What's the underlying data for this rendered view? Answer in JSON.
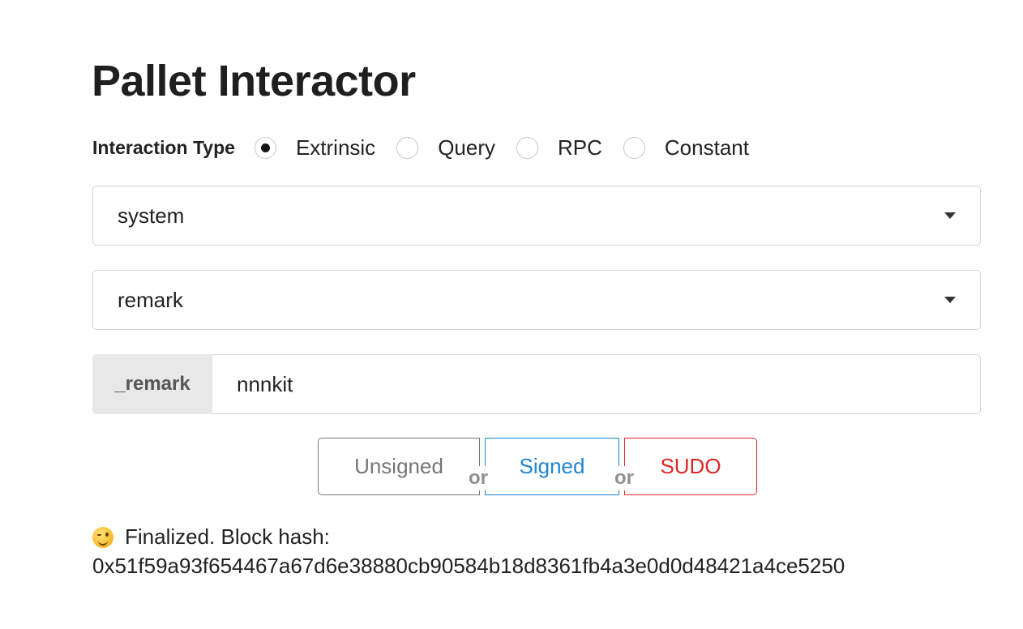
{
  "page": {
    "title": "Pallet Interactor"
  },
  "interaction_type": {
    "label": "Interaction Type",
    "options": [
      {
        "label": "Extrinsic",
        "checked": true
      },
      {
        "label": "Query",
        "checked": false
      },
      {
        "label": "RPC",
        "checked": false
      },
      {
        "label": "Constant",
        "checked": false
      }
    ]
  },
  "pallet_select": {
    "value": "system"
  },
  "callable_select": {
    "value": "remark"
  },
  "param_input": {
    "label": "_remark",
    "value": "nnnkit"
  },
  "buttons": {
    "unsigned_label": "Unsigned",
    "signed_label": "Signed",
    "sudo_label": "SUDO",
    "or_label": "or",
    "colors": {
      "unsigned": "#767676",
      "signed": "#2185d0",
      "sudo": "#db2828"
    }
  },
  "status": {
    "icon": "winking-face-icon",
    "message": "Finalized. Block hash:",
    "block_hash": "0x51f59a93f654467a67d6e38880cb90584b18d8361fb4a3e0d0d48421a4ce5250"
  }
}
